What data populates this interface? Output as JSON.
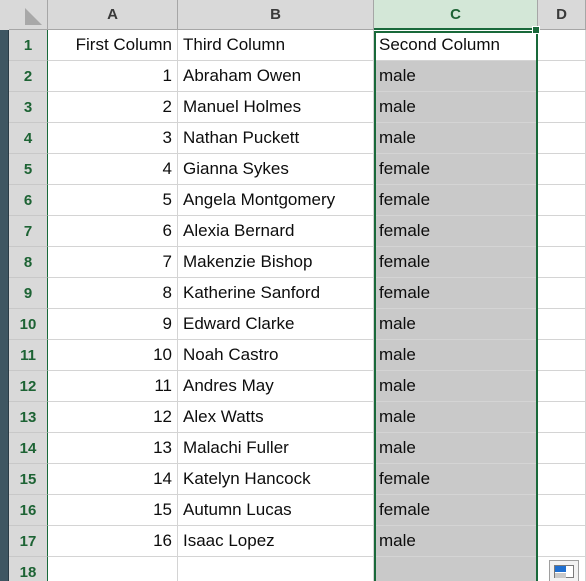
{
  "app": "spreadsheet",
  "grid": {
    "column_headers": [
      "A",
      "B",
      "C",
      "D"
    ],
    "selected_column": "C",
    "row_headers": [
      "1",
      "2",
      "3",
      "4",
      "5",
      "6",
      "7",
      "8",
      "9",
      "10",
      "11",
      "12",
      "13",
      "14",
      "15",
      "16",
      "17",
      "18"
    ],
    "columns": {
      "A": {
        "header_label": "A",
        "align": "right",
        "cells": [
          "First Column",
          "1",
          "2",
          "3",
          "4",
          "5",
          "6",
          "7",
          "8",
          "9",
          "10",
          "11",
          "12",
          "13",
          "14",
          "15",
          "16",
          ""
        ]
      },
      "B": {
        "header_label": "B",
        "align": "left",
        "cells": [
          "Third Column",
          "Abraham Owen",
          "Manuel Holmes",
          "Nathan Puckett",
          "Gianna Sykes",
          "Angela Montgomery",
          "Alexia Bernard",
          "Makenzie Bishop",
          "Katherine Sanford",
          "Edward Clarke",
          "Noah Castro",
          "Andres May",
          "Alex Watts",
          "Malachi Fuller",
          "Katelyn Hancock",
          "Autumn Lucas",
          "Isaac Lopez",
          ""
        ]
      },
      "C": {
        "header_label": "C",
        "align": "left",
        "selected": true,
        "cells": [
          "Second Column",
          "male",
          "male",
          "male",
          "female",
          "female",
          "female",
          "female",
          "female",
          "male",
          "male",
          "male",
          "male",
          "male",
          "female",
          "female",
          "male",
          ""
        ]
      },
      "D": {
        "header_label": "D",
        "align": "left",
        "cells": [
          "",
          "",
          "",
          "",
          "",
          "",
          "",
          "",
          "",
          "",
          "",
          "",
          "",
          "",
          "",
          "",
          "",
          ""
        ]
      }
    }
  },
  "overlays": {
    "paste_options_icon": "paste-options-icon",
    "select_all_icon": "select-all-corner-icon",
    "fill_handle": "fill-handle"
  },
  "colors": {
    "selection_border": "#19693a",
    "selected_header_fill": "#d3e7d7",
    "selected_cell_fill": "#c9c9c9",
    "header_fill": "#d9d9d9",
    "row_header_text": "#1d6334",
    "grid_line": "#d4d4d4"
  }
}
